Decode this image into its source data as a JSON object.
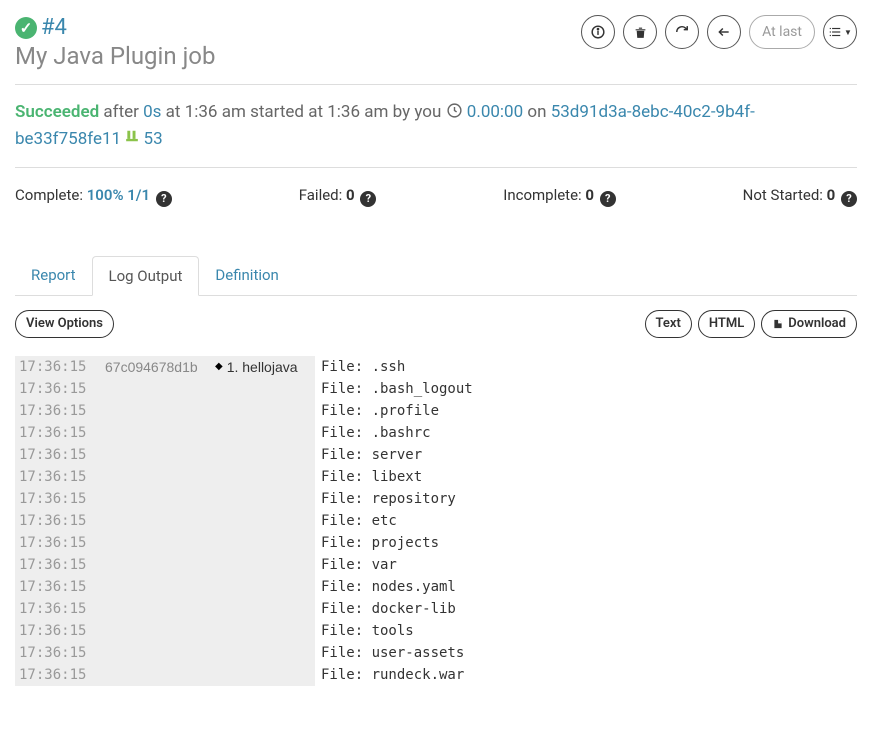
{
  "header": {
    "run_id": "#4",
    "job_title": "My Java Plugin job",
    "at_last": "At last"
  },
  "status": {
    "succeeded": "Succeeded",
    "after": "after",
    "duration": "0s",
    "at_time_prefix": "at",
    "at_time": "1:36 am",
    "started_prefix": "started at",
    "started_time": "1:36 am",
    "by_prefix": "by",
    "by_user": "you",
    "elapsed": "0.00:00",
    "on": "on",
    "uuid": "53d91d3a-8ebc-40c2-9b4f-be33f758fe11",
    "fork_count": "53"
  },
  "stats": {
    "complete_label": "Complete:",
    "complete_val": "100% 1/1",
    "failed_label": "Failed:",
    "failed_val": "0",
    "incomplete_label": "Incomplete:",
    "incomplete_val": "0",
    "notstarted_label": "Not Started:",
    "notstarted_val": "0"
  },
  "tabs": {
    "report": "Report",
    "log_output": "Log Output",
    "definition": "Definition"
  },
  "toolbar": {
    "view_options": "View Options",
    "text": "Text",
    "html": "HTML",
    "download": "Download"
  },
  "log": {
    "node": "67c094678d1b",
    "step": "1. hellojava",
    "rows": [
      {
        "time": "17:36:15",
        "msg": "File: .ssh"
      },
      {
        "time": "17:36:15",
        "msg": "File: .bash_logout"
      },
      {
        "time": "17:36:15",
        "msg": "File: .profile"
      },
      {
        "time": "17:36:15",
        "msg": "File: .bashrc"
      },
      {
        "time": "17:36:15",
        "msg": "File: server"
      },
      {
        "time": "17:36:15",
        "msg": "File: libext"
      },
      {
        "time": "17:36:15",
        "msg": "File: repository"
      },
      {
        "time": "17:36:15",
        "msg": "File: etc"
      },
      {
        "time": "17:36:15",
        "msg": "File: projects"
      },
      {
        "time": "17:36:15",
        "msg": "File: var"
      },
      {
        "time": "17:36:15",
        "msg": "File: nodes.yaml"
      },
      {
        "time": "17:36:15",
        "msg": "File: docker-lib"
      },
      {
        "time": "17:36:15",
        "msg": "File: tools"
      },
      {
        "time": "17:36:15",
        "msg": "File: user-assets"
      },
      {
        "time": "17:36:15",
        "msg": "File: rundeck.war"
      }
    ]
  }
}
